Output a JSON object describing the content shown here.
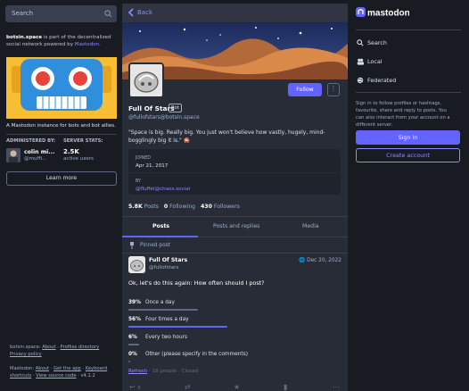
{
  "colors": {
    "accent": "#6364ff",
    "link": "#8c8dff",
    "bg_dark": "#191b22",
    "bg_panel": "#282c37"
  },
  "left": {
    "search_placeholder": "Search",
    "about_server": "botsin.space",
    "about_text_mid": " is part of the decentralized social network powered by ",
    "about_link": "Mastodon",
    "about_end": ".",
    "tagline": "A Mastodon instance for bots and bot allies.",
    "administered_by_label": "ADMINISTERED BY:",
    "server_stats_label": "SERVER STATS:",
    "admin_name": "colin mi...",
    "admin_handle": "@muffi...",
    "stats_count": "2.5K",
    "stats_label": "active users",
    "learn_more": "Learn more",
    "footer_line1_server": "botsin.space",
    "footer_about": "About",
    "footer_profiles": "Profiles directory",
    "footer_privacy": "Privacy policy",
    "footer_mastodon": "Mastodon",
    "footer_about2": "About",
    "footer_getapp": "Get the app",
    "footer_keyboard": "Keyboard shortcuts",
    "footer_source": "View source code",
    "footer_version": "v4.1.2"
  },
  "profile": {
    "back_label": "Back",
    "follow_label": "Follow",
    "more_label": "⋮",
    "display_name": "Full Of Stars",
    "bot_badge": "Bot",
    "account": "@fullofstars@botsin.space",
    "bio": "\"Space is big. Really big. You just won't believe how vastly, hugely, mind-bogglingly big it is.\" 🎇",
    "joined_label": "JOINED",
    "joined_value": "Apr 21, 2017",
    "by_label": "BY",
    "by_value": "@fluffel@chaos.social",
    "posts_count": "5.8K",
    "posts_label": "Posts",
    "following_count": "0",
    "following_label": "Following",
    "followers_count": "430",
    "followers_label": "Followers"
  },
  "tabs": [
    {
      "label": "Posts"
    },
    {
      "label": "Posts and replies"
    },
    {
      "label": "Media"
    }
  ],
  "post": {
    "pinned_label": "Pinned post",
    "author": "Full Of Stars",
    "author_acct": "@fullofstars",
    "date": "Dec 20, 2022",
    "text": "Ok, let's do this again: How often should I post?",
    "poll": [
      {
        "pct": "39%",
        "option": "Once a day",
        "value": 0.39
      },
      {
        "pct": "56%",
        "option": "Four times a day",
        "value": 0.56
      },
      {
        "pct": "6%",
        "option": "Every two hours",
        "value": 0.06
      },
      {
        "pct": "0%",
        "option": "Other (please specify in the comments)",
        "value": 0.0
      }
    ],
    "refresh_label": "Refresh",
    "poll_meta": " · 18 people · Closed",
    "reply_count": "8"
  },
  "right": {
    "logo_text": "mastodon",
    "nav": [
      {
        "icon": "search-icon",
        "label": "Search"
      },
      {
        "icon": "users-icon",
        "label": "Local"
      },
      {
        "icon": "globe-icon",
        "label": "Federated"
      }
    ],
    "signin_text": "Sign in to follow profiles or hashtags, favourite, share and reply to posts. You can also interact from your account on a different server.",
    "signin_label": "Sign in",
    "create_label": "Create account"
  }
}
